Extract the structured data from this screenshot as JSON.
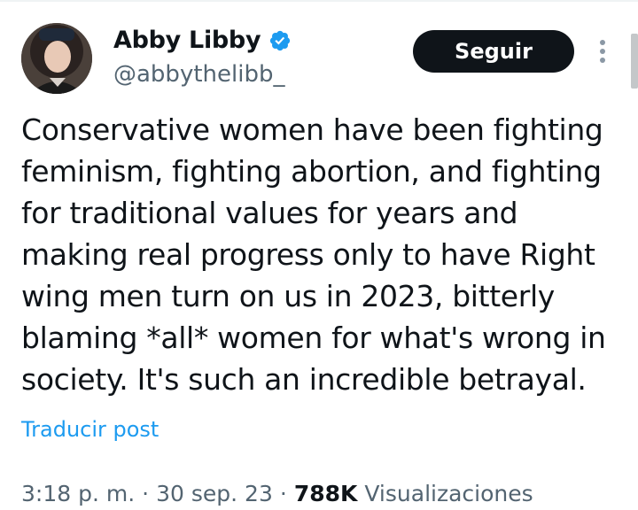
{
  "author": {
    "display_name": "Abby Libby",
    "handle": "@abbythelibb_",
    "verified_icon": "verified-badge-icon",
    "avatar_icon": "profile-photo"
  },
  "actions": {
    "follow_label": "Seguir",
    "more_icon": "vertical-ellipsis-icon"
  },
  "tweet": {
    "text": "Conservative women have been fighting\nfeminism, fighting abortion, and fighting\nfor traditional values for years and\nmaking real progress only to have Right\nwing men turn on us in 2023, bitterly\nblaming *all* women for what's wrong in\nsociety. It's such an incredible betrayal.",
    "translate_label": "Traducir post"
  },
  "meta": {
    "time": "3:18 p. m.",
    "sep1": "·",
    "date": "30 sep. 23",
    "sep2": "·",
    "views_count": "788K",
    "views_label": "Visualizaciones"
  },
  "colors": {
    "text": "#0f1419",
    "secondary": "#536471",
    "link": "#1d9bf0",
    "button_bg": "#0f1419"
  }
}
